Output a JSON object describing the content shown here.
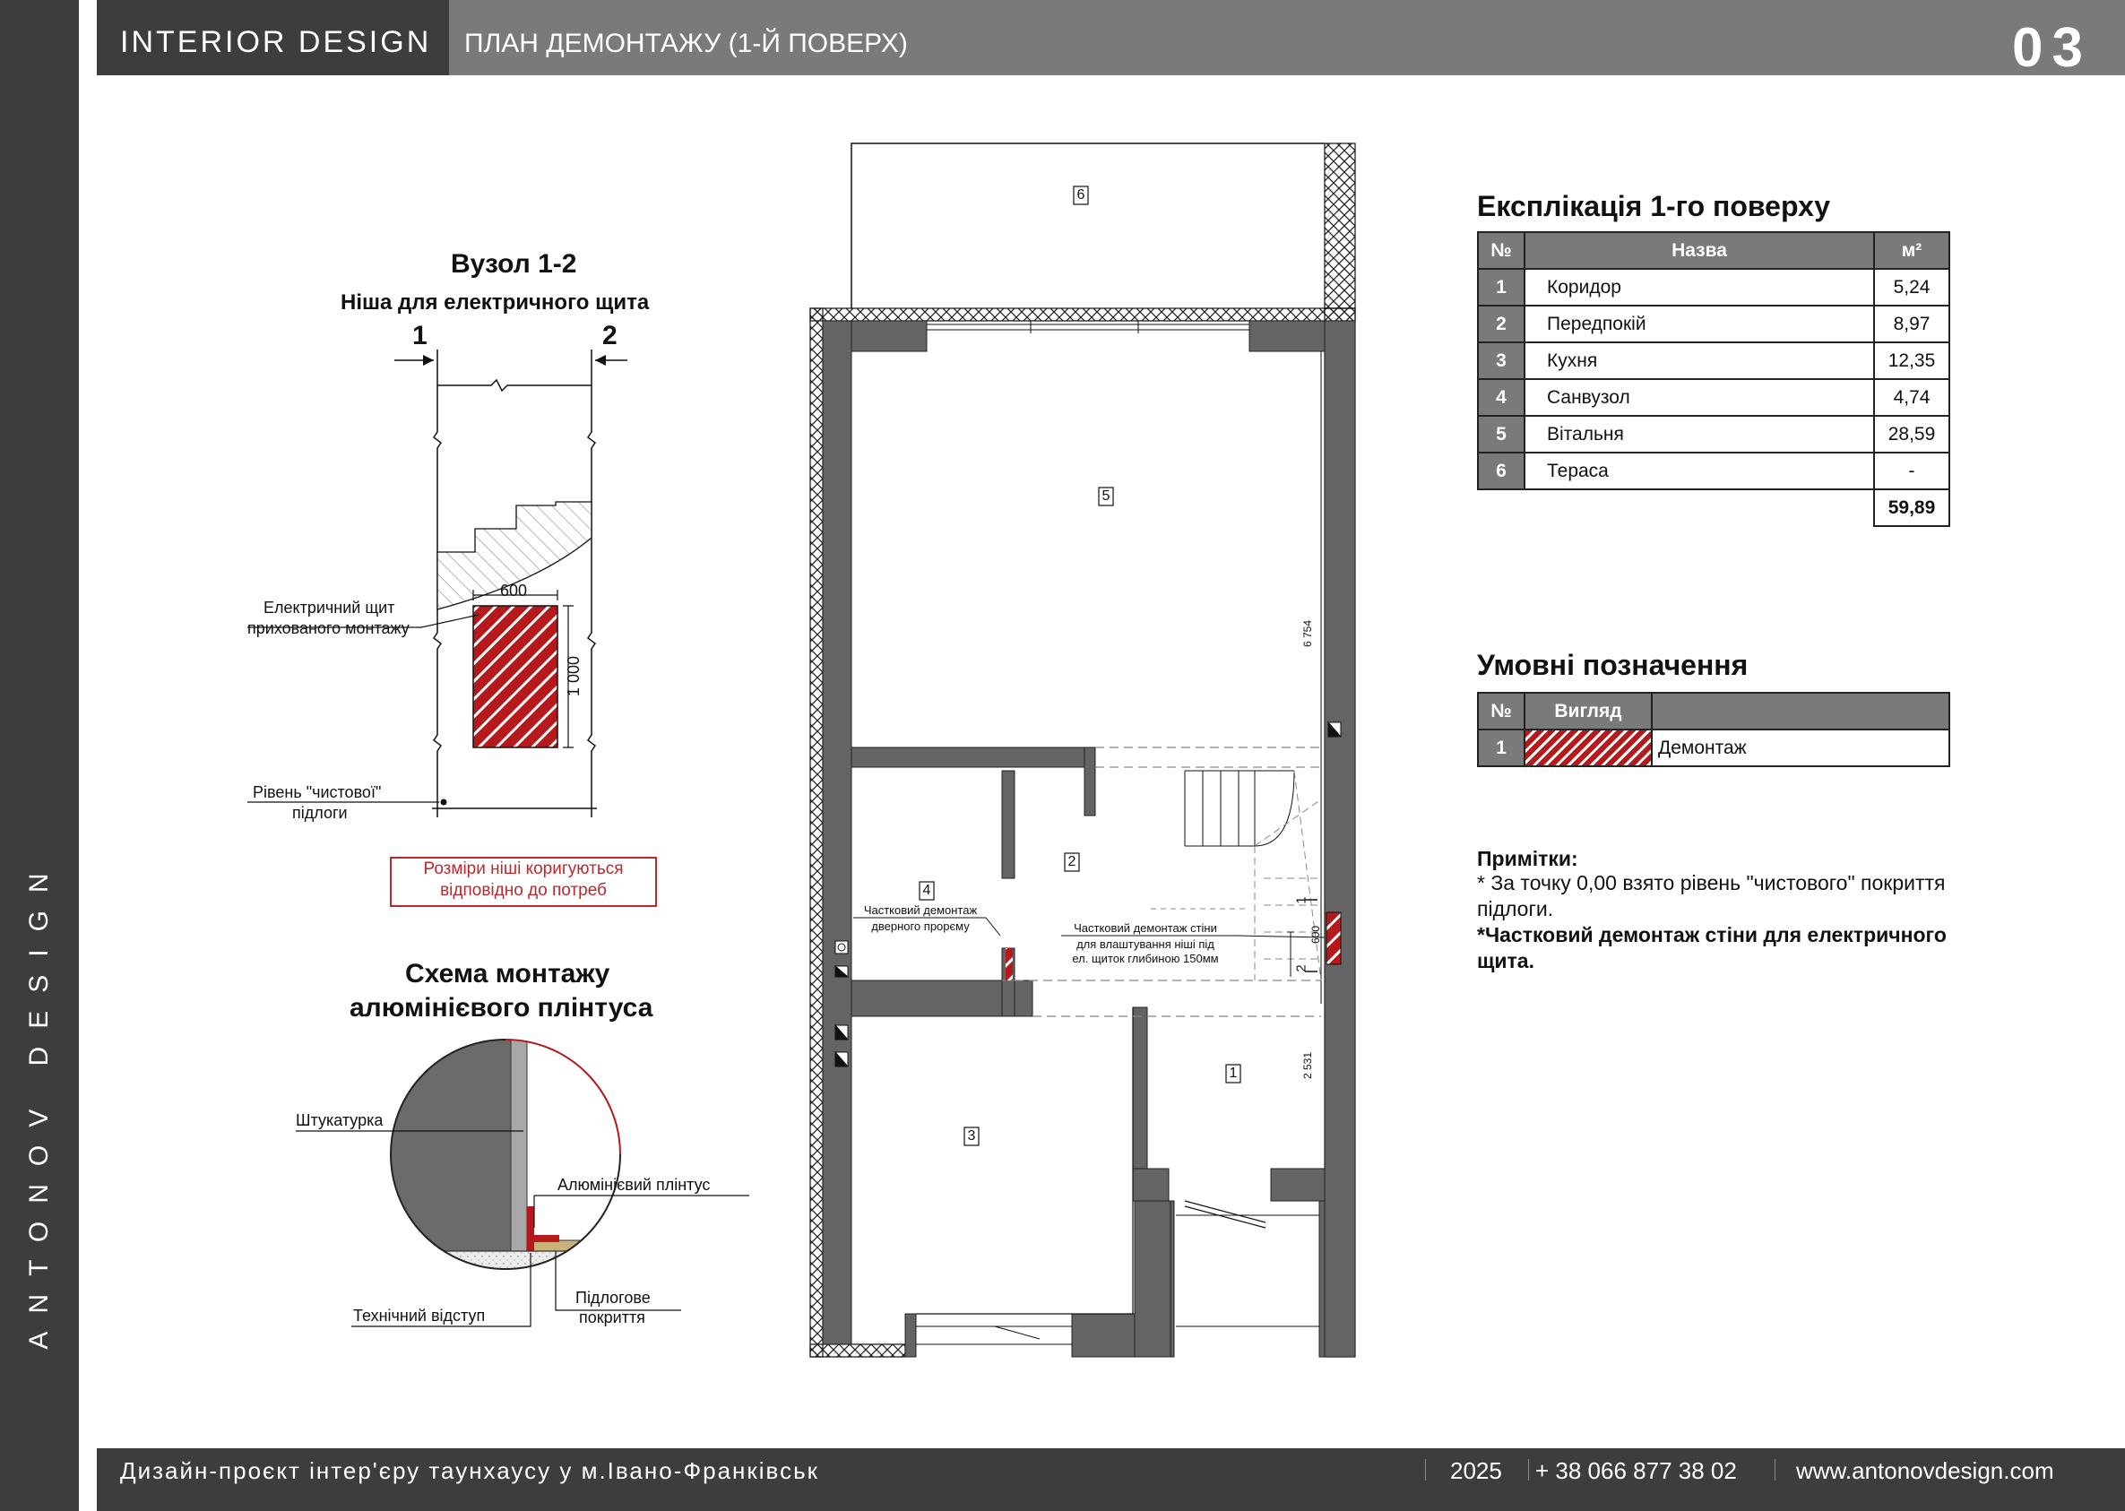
{
  "side": {
    "brand": "ANTONOV DESIGN"
  },
  "header": {
    "brand": "INTERIOR DESIGN",
    "title": "ПЛАН ДЕМОНТАЖУ (1-Й ПОВЕРХ)",
    "page": "03"
  },
  "footer": {
    "project": "Дизайн-проєкт інтер'єру таунхаусу у м.Івано-Франківськ",
    "year": "2025",
    "phone": "+ 38 066 877 38 02",
    "site": "www.antonovdesign.com"
  },
  "node": {
    "title": "Вузол 1-2",
    "subtitle": "Ніша для електричного щита",
    "section_left": "1",
    "section_right": "2",
    "panel_label_1": "Електричний щит",
    "panel_label_2": "прихованого монтажу",
    "width_dim": "600",
    "height_dim": "1 000",
    "floor_label_1": "Рівень \"чистової\"",
    "floor_label_2": "підлоги",
    "warning_1": "Розміри ніші коригуються",
    "warning_2": "відповідно до потреб"
  },
  "skirting": {
    "title_1": "Схема монтажу",
    "title_2": "алюмінієвого плінтуса",
    "plaster": "Штукатурка",
    "aluminum": "Алюмінієвий плінтус",
    "gap": "Технічний відступ",
    "floor_1": "Підлогове",
    "floor_2": "покриття"
  },
  "plan": {
    "room_tags": [
      "6",
      "5",
      "4",
      "2",
      "3",
      "1"
    ],
    "door_note_1": "Частковий демонтаж",
    "door_note_2": "дверного прорєму",
    "wall_note_1": "Частковий демонтаж стіни",
    "wall_note_2": "для влаштування ніші під",
    "wall_note_3": "ел. щиток глибиною 150мм",
    "dim_upper": "6 754",
    "dim_lower": "2 531",
    "dim_niche": "600",
    "section_1": "1",
    "section_2": "2"
  },
  "explication": {
    "title": "Експлікація 1-го поверху",
    "headers": {
      "num": "№",
      "name": "Назва",
      "area": "м²"
    },
    "rows": [
      {
        "num": "1",
        "name": "Коридор",
        "area": "5,24"
      },
      {
        "num": "2",
        "name": "Передпокій",
        "area": "8,97"
      },
      {
        "num": "3",
        "name": "Кухня",
        "area": "12,35"
      },
      {
        "num": "4",
        "name": "Санвузол",
        "area": "4,74"
      },
      {
        "num": "5",
        "name": "Вітальня",
        "area": "28,59"
      },
      {
        "num": "6",
        "name": "Тераса",
        "area": "-"
      }
    ],
    "total": "59,89"
  },
  "legend": {
    "title": "Умовні позначення",
    "headers": {
      "num": "№",
      "view": "Вигляд"
    },
    "rows": [
      {
        "num": "1",
        "label": "Демонтаж"
      }
    ],
    "hatch_color": "#b5191b"
  },
  "notes": {
    "title": "Примітки:",
    "line_1a": "* За точку 0,00 взято рівень \"чистового\" покриття",
    "line_1b": "підлоги.",
    "line_2a": "*Частковий демонтаж стіни для електричного",
    "line_2b": "щита."
  },
  "colors": {
    "band": "#3d3d3d",
    "header_right": "#7a7a7a",
    "wall": "#646464",
    "demolition": "#b5191b"
  }
}
